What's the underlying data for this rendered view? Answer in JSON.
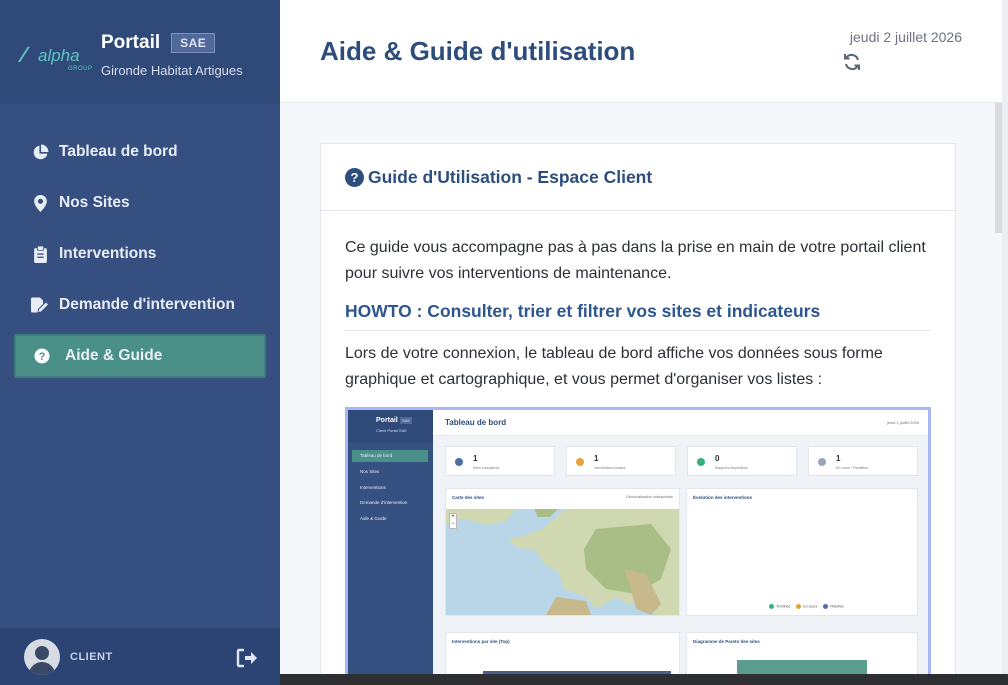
{
  "sidebar": {
    "brand_title": "Portail",
    "brand_badge": "SAE",
    "brand_subtitle": "Gironde Habitat Artigues",
    "logo_text": "alpha",
    "logo_sub": "GROUP",
    "items": [
      {
        "label": "Tableau de bord",
        "icon": "pie-chart-icon",
        "active": false
      },
      {
        "label": "Nos Sites",
        "icon": "map-pin-icon",
        "active": false
      },
      {
        "label": "Interventions",
        "icon": "clipboard-icon",
        "active": false
      },
      {
        "label": "Demande d'intervention",
        "icon": "edit-document-icon",
        "active": false
      },
      {
        "label": "Aide & Guide",
        "icon": "question-circle-icon",
        "active": true
      }
    ],
    "footer_label": "CLIENT"
  },
  "header": {
    "title": "Aide & Guide d'utilisation",
    "date": "jeudi 2 juillet 2026"
  },
  "guide": {
    "title": "Guide d'Utilisation - Espace Client",
    "intro": "Ce guide vous accompagne pas à pas dans la prise en main de votre portail client pour suivre vos interventions de maintenance.",
    "howto_title": "HOWTO : Consulter, trier et filtrer vos sites et indicateurs",
    "howto_text": "Lors de votre connexion, le tableau de bord affiche vos données sous forme graphique et cartographique, et vous permet d'organiser vos listes :"
  },
  "screenshot": {
    "brand": "Portail",
    "badge": "SAE",
    "brand_sub": "Client Portal SAE",
    "nav": [
      "Tableau de bord",
      "Nos Sites",
      "Interventions",
      "Demande d'intervention",
      "Aide & Guide"
    ],
    "title": "Tableau de bord",
    "date": "jeudi 2 juillet 2026",
    "kpis": [
      {
        "value": "1",
        "label": "Sites enregistrés",
        "color": "#4b6ea6"
      },
      {
        "value": "1",
        "label": "Interventions totales",
        "color": "#e9a23b"
      },
      {
        "value": "0",
        "label": "Rapports disponibles",
        "color": "#34b27d"
      },
      {
        "value": "1",
        "label": "En cours / Planifiées",
        "color": "#9aa5b8"
      }
    ],
    "panel_map_title": "Carte des sites",
    "panel_map_right": "Géolocalisation indisponible",
    "panel_evo_title": "Évolution des interventions",
    "panel_top_title": "Interventions par site (Top)",
    "panel_pareto_title": "Diagramme de Pareto des sites",
    "legend": [
      "Terminée",
      "En cours",
      "Planifiée"
    ],
    "colors": {
      "accent": "#2d4d7c",
      "active": "#4a9088"
    }
  }
}
